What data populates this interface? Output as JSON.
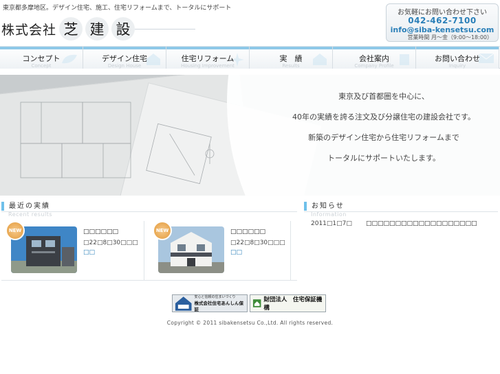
{
  "header": {
    "tagline": "東京都多摩地区。デザイン住宅、施工、住宅リフォームまで、トータルにサポート",
    "logo_corp": "株式会社",
    "logo_chars": [
      "芝",
      "建",
      "設"
    ],
    "contact": {
      "heading": "お気軽にお問い合わせ下さい",
      "tel": "042-462-7100",
      "email": "info@siba-kensetsu.com",
      "hours": "営業時間 月～金（9:00～18:00）"
    }
  },
  "nav": [
    {
      "label": "コンセプト",
      "sub": "Concept"
    },
    {
      "label": "デザイン住宅",
      "sub": "Design House"
    },
    {
      "label": "住宅リフォーム",
      "sub": "Housing Improvement"
    },
    {
      "label": "実　績",
      "sub": "Results"
    },
    {
      "label": "会社案内",
      "sub": "Company Profile"
    },
    {
      "label": "お問い合わせ",
      "sub": "Inquiry"
    }
  ],
  "hero": {
    "lines": [
      "東京及び首都圏を中心に、",
      "40年の実績を誇る注文及び分譲住宅の建設会社です。",
      "新築のデザイン住宅から住宅リフォームまで",
      "トータルにサポートいたします。"
    ]
  },
  "results": {
    "heading": "最近の実績",
    "sub": "Recent results",
    "badge": "NEW",
    "items": [
      {
        "title": "□□□□□□",
        "date": "□22□8□30□□□",
        "link": "□□"
      },
      {
        "title": "□□□□□□",
        "date": "□22□8□30□□□",
        "link": "□□"
      }
    ]
  },
  "news": {
    "heading": "お知らせ",
    "sub": "Information",
    "items": [
      {
        "date": "2011□1□7□",
        "title": "□□□□□□□□□□□□□□□□□□□"
      }
    ]
  },
  "banners": {
    "anshin": {
      "small": "安心と信頼の住まいづくり",
      "name": "株式会社住宅あんしん保証",
      "mark": "あんしん"
    },
    "hoshou": {
      "name": "財団法人　住宅保証機構"
    }
  },
  "footer": {
    "copyright": "Copyright © 2011 sibakensetsu Co.,Ltd. All rights reserved."
  },
  "colors": {
    "accent": "#6fc0ea",
    "link": "#2a7fb8"
  }
}
